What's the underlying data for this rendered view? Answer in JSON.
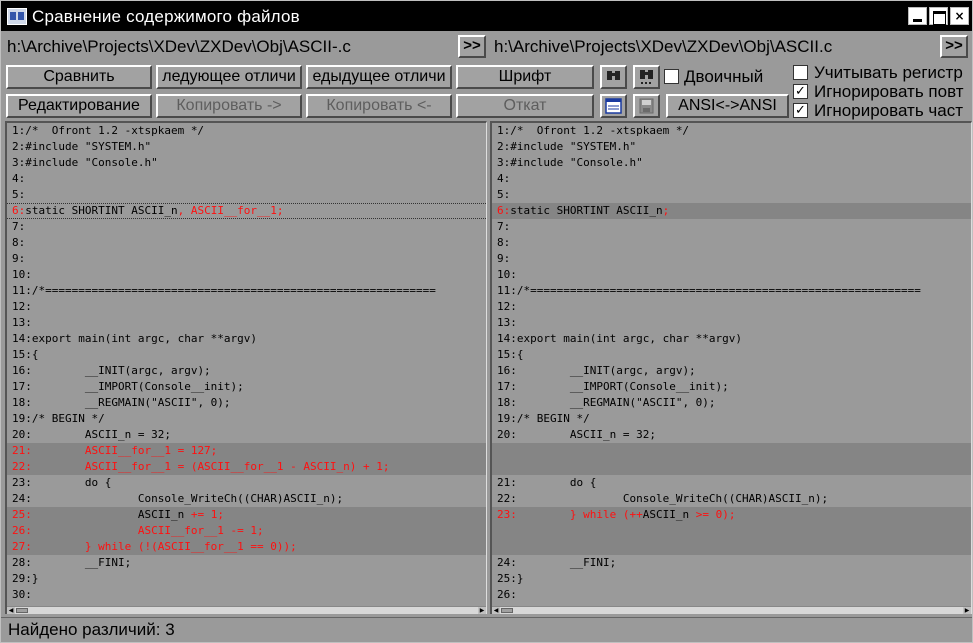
{
  "window": {
    "title": "Сравнение содержимого файлов",
    "min_label": "_",
    "max_label": "□",
    "close_label": "×"
  },
  "paths": {
    "left": "h:\\Archive\\Projects\\XDev\\ZXDev\\Obj\\ASCII-.c",
    "right": "h:\\Archive\\Projects\\XDev\\ZXDev\\Obj\\ASCII.c",
    "browse_label": ">>"
  },
  "toolbar": {
    "compare": "Сравнить",
    "next_diff": "ледующее отличи",
    "prev_diff": "едыдущее отличи",
    "font": "Шрифт",
    "edit": "Редактирование",
    "copy_right": "Копировать ->",
    "copy_left": "Копировать <-",
    "undo": "Откат",
    "encoding": "ANSI<->ANSI",
    "binary": "Двоичный",
    "case_sensitive": "Учитывать регистр",
    "ignore_repeat": "Игнорировать повт",
    "ignore_part": "Игнорировать част"
  },
  "options": {
    "binary": false,
    "case_sensitive": false,
    "ignore_repeat": true,
    "ignore_part": true
  },
  "left_lines": [
    {
      "no": "1:",
      "text": "/*  Ofront 1.2 -xtspkaem */",
      "diff": false
    },
    {
      "no": "2:",
      "text": "#include \"SYSTEM.h\"",
      "diff": false
    },
    {
      "no": "3:",
      "text": "#include \"Console.h\"",
      "diff": false
    },
    {
      "no": "4:",
      "text": "",
      "diff": false
    },
    {
      "no": "5:",
      "text": "",
      "diff": false
    },
    {
      "no": "6:",
      "text": "static SHORTINT ASCII_n",
      "red": ", ASCII__for__1;",
      "diff": false,
      "sel": true
    },
    {
      "no": "7:",
      "text": "",
      "diff": false
    },
    {
      "no": "8:",
      "text": "",
      "diff": false
    },
    {
      "no": "9:",
      "text": "",
      "diff": false
    },
    {
      "no": "10:",
      "text": "",
      "diff": false
    },
    {
      "no": "11:",
      "text": "/*===========================================================",
      "diff": false
    },
    {
      "no": "12:",
      "text": "",
      "diff": false
    },
    {
      "no": "13:",
      "text": "",
      "diff": false
    },
    {
      "no": "14:",
      "text": "export main(int argc, char **argv)",
      "diff": false
    },
    {
      "no": "15:",
      "text": "{",
      "diff": false
    },
    {
      "no": "16:",
      "text": "        __INIT(argc, argv);",
      "diff": false
    },
    {
      "no": "17:",
      "text": "        __IMPORT(Console__init);",
      "diff": false
    },
    {
      "no": "18:",
      "text": "        __REGMAIN(\"ASCII\", 0);",
      "diff": false
    },
    {
      "no": "19:",
      "text": "/* BEGIN */",
      "diff": false
    },
    {
      "no": "20:",
      "text": "        ASCII_n = 32;",
      "diff": false
    },
    {
      "no": "21:",
      "text": "",
      "red": "        ASCII__for__1 = 127;",
      "diff": true
    },
    {
      "no": "22:",
      "text": "",
      "red": "        ASCII__for__1 = (ASCII__for__1 - ASCII_n) + 1;",
      "diff": true
    },
    {
      "no": "23:",
      "text": "        do {",
      "diff": false
    },
    {
      "no": "24:",
      "text": "                Console_WriteCh((CHAR)ASCII_n);",
      "diff": false
    },
    {
      "no": "25:",
      "text": "                ASCII_n ",
      "red": "+= 1;",
      "diff": true
    },
    {
      "no": "26:",
      "text": "",
      "red": "                ASCII__for__1 -= 1;",
      "diff": true
    },
    {
      "no": "27:",
      "text": "",
      "red": "        } while (!(ASCII__for__1 == 0));",
      "diff": true
    },
    {
      "no": "28:",
      "text": "        __FINI;",
      "diff": false
    },
    {
      "no": "29:",
      "text": "}",
      "diff": false
    },
    {
      "no": "30:",
      "text": "",
      "diff": false
    }
  ],
  "right_lines": [
    {
      "no": "1:",
      "text": "/*  Ofront 1.2 -xtspkaem */",
      "diff": false
    },
    {
      "no": "2:",
      "text": "#include \"SYSTEM.h\"",
      "diff": false
    },
    {
      "no": "3:",
      "text": "#include \"Console.h\"",
      "diff": false
    },
    {
      "no": "4:",
      "text": "",
      "diff": false
    },
    {
      "no": "5:",
      "text": "",
      "diff": false
    },
    {
      "no": "6:",
      "text": "static SHORTINT ASCII_n",
      "red": ";",
      "diff": true
    },
    {
      "no": "7:",
      "text": "",
      "diff": false
    },
    {
      "no": "8:",
      "text": "",
      "diff": false
    },
    {
      "no": "9:",
      "text": "",
      "diff": false
    },
    {
      "no": "10:",
      "text": "",
      "diff": false
    },
    {
      "no": "11:",
      "text": "/*===========================================================",
      "diff": false
    },
    {
      "no": "12:",
      "text": "",
      "diff": false
    },
    {
      "no": "13:",
      "text": "",
      "diff": false
    },
    {
      "no": "14:",
      "text": "export main(int argc, char **argv)",
      "diff": false
    },
    {
      "no": "15:",
      "text": "{",
      "diff": false
    },
    {
      "no": "16:",
      "text": "        __INIT(argc, argv);",
      "diff": false
    },
    {
      "no": "17:",
      "text": "        __IMPORT(Console__init);",
      "diff": false
    },
    {
      "no": "18:",
      "text": "        __REGMAIN(\"ASCII\", 0);",
      "diff": false
    },
    {
      "no": "19:",
      "text": "/* BEGIN */",
      "diff": false
    },
    {
      "no": "20:",
      "text": "        ASCII_n = 32;",
      "diff": false
    },
    {
      "no": "",
      "text": "",
      "diff": true
    },
    {
      "no": "",
      "text": "",
      "diff": true
    },
    {
      "no": "21:",
      "text": "        do {",
      "diff": false
    },
    {
      "no": "22:",
      "text": "                Console_WriteCh((CHAR)ASCII_n);",
      "diff": false
    },
    {
      "no": "23:",
      "text": "",
      "red": "        } while (++",
      "text2": "ASCII_n ",
      "red2": ">= 0);",
      "diff": true
    },
    {
      "no": "",
      "text": "",
      "diff": true
    },
    {
      "no": "",
      "text": "",
      "diff": true
    },
    {
      "no": "24:",
      "text": "        __FINI;",
      "diff": false
    },
    {
      "no": "25:",
      "text": "}",
      "diff": false
    },
    {
      "no": "26:",
      "text": "",
      "diff": false
    }
  ],
  "status": "Найдено различий: 3",
  "colors": {
    "diff_text": "#ff1010",
    "diff_bg": "#858585",
    "panel": "#9a9a9a"
  }
}
